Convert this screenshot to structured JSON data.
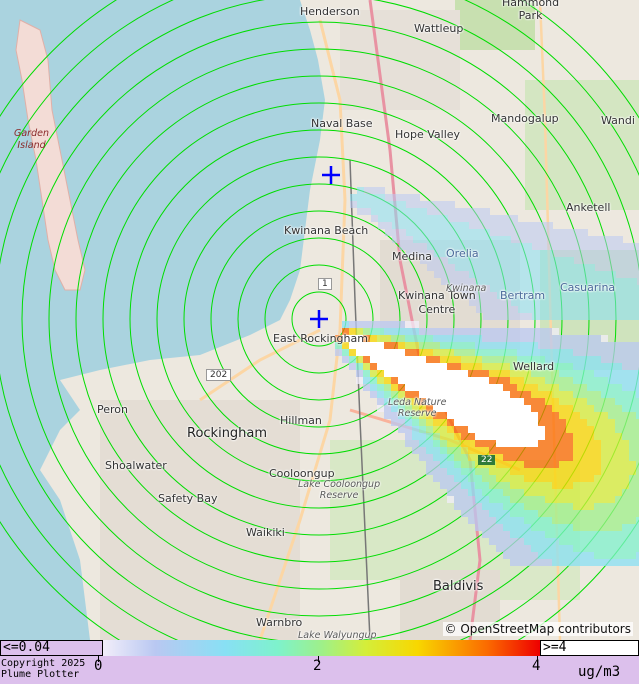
{
  "map": {
    "places": [
      {
        "key": "henderson",
        "label": "Henderson"
      },
      {
        "key": "hammond_park",
        "label": "Hammond\nPark"
      },
      {
        "key": "wattleup",
        "label": "Wattleup"
      },
      {
        "key": "naval_base",
        "label": "Naval Base"
      },
      {
        "key": "hope_valley",
        "label": "Hope Valley"
      },
      {
        "key": "mandogalup",
        "label": "Mandogalup"
      },
      {
        "key": "wandi",
        "label": "Wandi"
      },
      {
        "key": "anketell",
        "label": "Anketell"
      },
      {
        "key": "kwinana_beach",
        "label": "Kwinana Beach"
      },
      {
        "key": "medina",
        "label": "Medina"
      },
      {
        "key": "orelia",
        "label": "Orelia"
      },
      {
        "key": "casuarina",
        "label": "Casuarina"
      },
      {
        "key": "kwinana_town_centre",
        "label": "Kwinana Town\nCentre"
      },
      {
        "key": "bertram",
        "label": "Bertram"
      },
      {
        "key": "kwinana_small",
        "label": "Kwinana"
      },
      {
        "key": "east_rockingham",
        "label": "East Rockingham"
      },
      {
        "key": "wellard",
        "label": "Wellard"
      },
      {
        "key": "leda",
        "label": "Leda Nature\nReserve"
      },
      {
        "key": "peron",
        "label": "Peron"
      },
      {
        "key": "rockingham",
        "label": "Rockingham"
      },
      {
        "key": "hillman",
        "label": "Hillman"
      },
      {
        "key": "shoalwater",
        "label": "Shoalwater"
      },
      {
        "key": "cooloongup",
        "label": "Cooloongup"
      },
      {
        "key": "lake_cooloongup",
        "label": "Lake Cooloongup\nReserve"
      },
      {
        "key": "safety_bay",
        "label": "Safety Bay"
      },
      {
        "key": "waikiki",
        "label": "Waikiki"
      },
      {
        "key": "baldivis",
        "label": "Baldivis"
      },
      {
        "key": "warnbro",
        "label": "Warnbro"
      },
      {
        "key": "lake_walyungup",
        "label": "Lake Walyungup"
      },
      {
        "key": "garden_island",
        "label": "Garden\nIsland"
      }
    ],
    "road_shields": [
      {
        "key": "r1",
        "label": "1"
      },
      {
        "key": "r202",
        "label": "202"
      },
      {
        "key": "r22",
        "label": "22"
      }
    ],
    "attribution": "© OpenStreetMap contributors",
    "sources": [
      {
        "name": "source-marker-north",
        "color": "#0000ff"
      },
      {
        "name": "source-marker-south",
        "color": "#0000ff"
      }
    ],
    "ring_color": "#00dd00"
  },
  "legend": {
    "min_label": "<=0.04",
    "max_label": ">=4",
    "ticks": [
      "0",
      "2",
      "4"
    ],
    "units": "ug/m3",
    "copyright": "Copyright 2025\nPlume Plotter",
    "scale_colors": [
      "#f2eefa",
      "#b9c8f2",
      "#88e0f4",
      "#7ef2cc",
      "#9ef08a",
      "#d4ee3a",
      "#f8d700",
      "#fb6a00",
      "#ee0000"
    ]
  }
}
